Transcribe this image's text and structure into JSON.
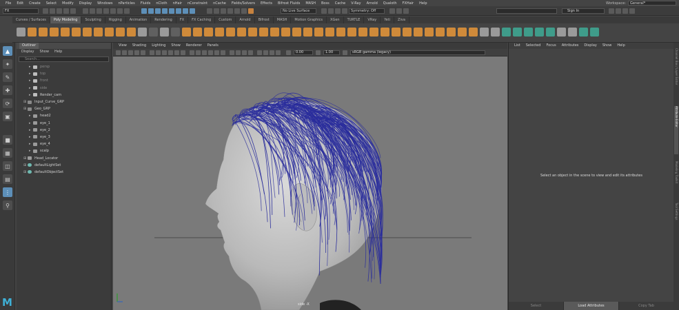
{
  "menubar": {
    "items": [
      "File",
      "Edit",
      "Create",
      "Select",
      "Modify",
      "Display",
      "Windows",
      "nParticles",
      "Fluids",
      "nCloth",
      "nHair",
      "nConstraint",
      "nCache",
      "Fields/Solvers",
      "Effects",
      "Bifrost Fluids",
      "MASH",
      "Boss",
      "Cache",
      "V-Ray",
      "Arnold",
      "Qualoth",
      "FXHair",
      "Help"
    ],
    "workspace_label": "Workspace:",
    "workspace_value": "General*"
  },
  "status_line": {
    "mode": "FX",
    "live_surface": "No Live Surface",
    "symmetry": "Symmetry: Off",
    "sign_in": "Sign In"
  },
  "shelf": {
    "tabs": [
      "Curves / Surfaces",
      "Poly Modeling",
      "Sculpting",
      "Rigging",
      "Animation",
      "Rendering",
      "FX",
      "FX Caching",
      "Custom",
      "Arnold",
      "Bifrost",
      "MASH",
      "Motion Graphics",
      "XGen",
      "TURTLE",
      "VRay",
      "Yeti",
      "Ziva"
    ],
    "active_tab": "Poly Modeling"
  },
  "outliner": {
    "title": "Outliner",
    "menu": [
      "Display",
      "Show",
      "Help"
    ],
    "search_placeholder": "Search...",
    "items": [
      {
        "label": "persp",
        "icon": "camera-icon",
        "dim": true,
        "indent": 1
      },
      {
        "label": "top",
        "icon": "camera-icon",
        "dim": true,
        "indent": 1
      },
      {
        "label": "front",
        "icon": "camera-icon",
        "dim": true,
        "indent": 1
      },
      {
        "label": "side",
        "icon": "camera-icon",
        "dim": true,
        "indent": 1
      },
      {
        "label": "Render_cam",
        "icon": "camera-icon",
        "dim": false,
        "indent": 1
      },
      {
        "label": "Input_Curve_GRP",
        "icon": "group-icon",
        "dim": false,
        "indent": 0
      },
      {
        "label": "Geo_GRP",
        "icon": "group-icon",
        "dim": false,
        "indent": 0
      },
      {
        "label": "head2",
        "icon": "mesh-icon",
        "dim": false,
        "indent": 1
      },
      {
        "label": "eye_1",
        "icon": "mesh-icon",
        "dim": false,
        "indent": 1
      },
      {
        "label": "eye_2",
        "icon": "mesh-icon",
        "dim": false,
        "indent": 1
      },
      {
        "label": "eye_3",
        "icon": "mesh-icon",
        "dim": false,
        "indent": 1
      },
      {
        "label": "eye_4",
        "icon": "mesh-icon",
        "dim": false,
        "indent": 1
      },
      {
        "label": "scalp",
        "icon": "mesh-icon",
        "dim": false,
        "indent": 1
      },
      {
        "label": "Head_Locator",
        "icon": "locator-icon",
        "dim": false,
        "indent": 0
      },
      {
        "label": "defaultLightSet",
        "icon": "set-icon",
        "dim": false,
        "indent": 0
      },
      {
        "label": "defaultObjectSet",
        "icon": "set-icon",
        "dim": false,
        "indent": 0
      }
    ]
  },
  "viewport": {
    "menu": [
      "View",
      "Shading",
      "Lighting",
      "Show",
      "Renderer",
      "Panels"
    ],
    "exposure": "0.00",
    "gamma": "1.00",
    "color_space": "sRGB gamma (legacy)",
    "camera_label": "side -X"
  },
  "attribute_editor": {
    "menu": [
      "List",
      "Selected",
      "Focus",
      "Attributes",
      "Display",
      "Show",
      "Help"
    ],
    "empty_message": "Select an object in the scene to view and edit its attributes",
    "buttons": [
      "Select",
      "Load Attributes",
      "Copy Tab"
    ],
    "active_button": "Load Attributes"
  },
  "side_tabs": [
    "Channel Box / Layer Editor",
    "Attribute Editor",
    "Modeling Toolkit",
    "Tool Settings"
  ],
  "colors": {
    "hair": "#2a2d9c",
    "viewport_bg": "#7a7a7a",
    "active_blue": "#5d8fb8",
    "shelf_orange": "#cf8a3a",
    "maya_logo": "#3fb0d6"
  }
}
